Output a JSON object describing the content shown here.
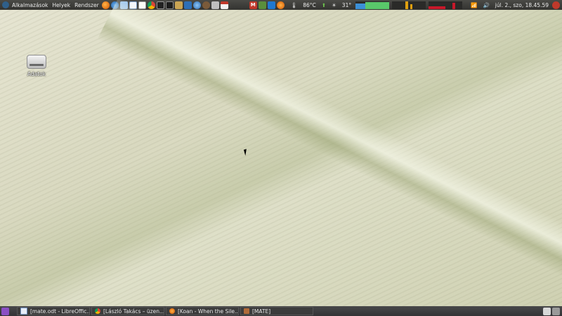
{
  "top_panel": {
    "menus": [
      "Alkalmazások",
      "Helyek",
      "Rendszer"
    ],
    "launcher_icons": [
      "firefox-icon",
      "thunderbird-icon",
      "network-icon",
      "writer-icon",
      "text-editor-icon",
      "chrome-icon",
      "terminal-icon",
      "terminal-2-icon",
      "box-icon",
      "virtualbox-icon",
      "globe-icon",
      "settings-icon",
      "camera-icon",
      "calendar-icon"
    ],
    "tray": {
      "temperature": "86°C",
      "weather_temp": "31°",
      "clock": "júl. 2., szo, 18.45.59"
    },
    "colors": {
      "panel": "#3a3a37",
      "graph_blue": "#3b8fd6",
      "graph_green": "#59c76a",
      "graph_orange": "#e0a010",
      "graph_red": "#c8182a"
    }
  },
  "desktop": {
    "icon_label": "Adatok"
  },
  "bottom_panel": {
    "tasks": [
      {
        "label": "[mate.odt - LibreOffic...",
        "icon": "writer-icon"
      },
      {
        "label": "[László Takács – üzen...",
        "icon": "chrome-icon"
      },
      {
        "label": "[Koan - When the Sile...",
        "icon": "firefox-icon"
      },
      {
        "label": "[MATE]",
        "icon": "folder-icon"
      }
    ]
  }
}
